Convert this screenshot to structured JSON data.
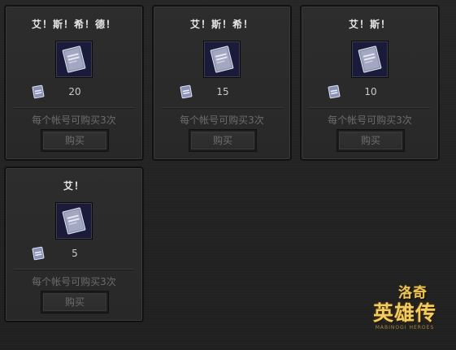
{
  "cards": [
    {
      "title": "艾！斯！希！德！",
      "price": "20",
      "limit": "每个帐号可购买3次",
      "buy_label": "购买"
    },
    {
      "title": "艾！斯！希！",
      "price": "15",
      "limit": "每个帐号可购买3次",
      "buy_label": "购买"
    },
    {
      "title": "艾！斯！",
      "price": "10",
      "limit": "每个帐号可购买3次",
      "buy_label": "购买"
    },
    {
      "title": "艾！",
      "price": "5",
      "limit": "每个帐号可购买3次",
      "buy_label": "购买"
    }
  ],
  "logo": {
    "line1": "洛奇",
    "line2": "英雄传",
    "line3": "MABINOGI HEROES"
  },
  "colors": {
    "background": "#232323",
    "card": "#2b2b2b",
    "title_text": "#e8e8e8",
    "muted_text": "#6c6c6c",
    "logo_gold": "#f0cc62"
  },
  "icons": {
    "item": "grey-ticket-card-icon",
    "currency": "small-coupon-icon"
  }
}
